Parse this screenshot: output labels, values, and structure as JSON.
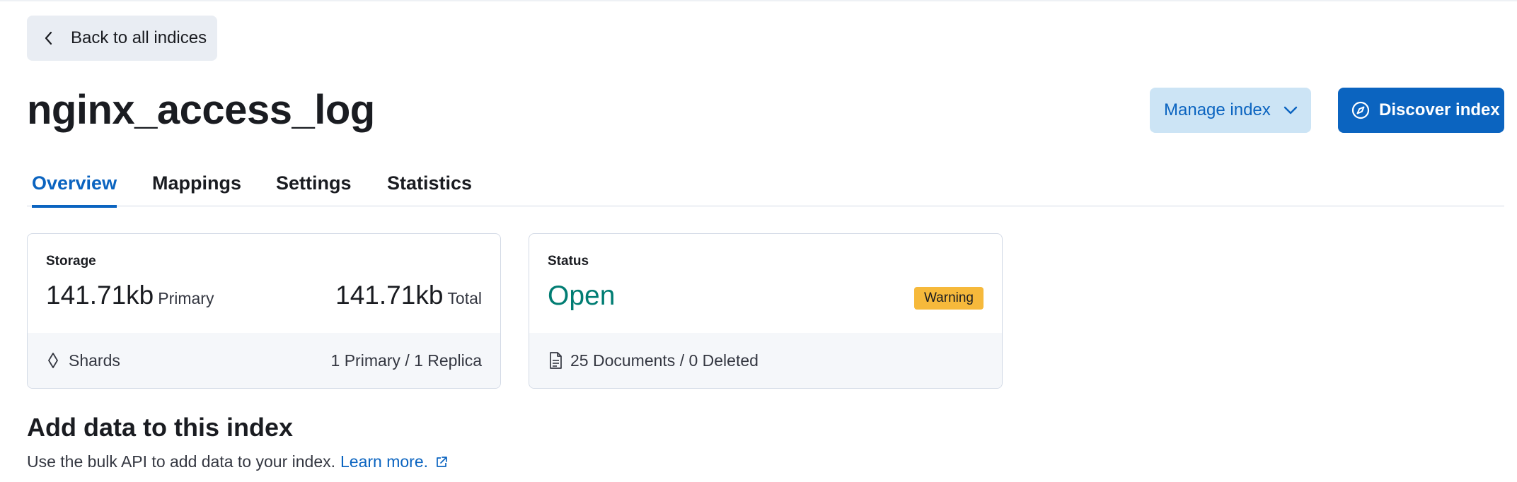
{
  "back_button": {
    "label": "Back to all indices",
    "icon": "chevron-left-icon"
  },
  "page_title": "nginx_access_log",
  "header_actions": {
    "manage_label": "Manage index",
    "discover_label": "Discover index"
  },
  "tabs": [
    {
      "label": "Overview",
      "active": true
    },
    {
      "label": "Mappings",
      "active": false
    },
    {
      "label": "Settings",
      "active": false
    },
    {
      "label": "Statistics",
      "active": false
    }
  ],
  "storage_card": {
    "label": "Storage",
    "primary_value": "141.71kb",
    "primary_unit": "Primary",
    "total_value": "141.71kb",
    "total_unit": "Total",
    "footer_label": "Shards",
    "footer_value": "1 Primary / 1 Replica"
  },
  "status_card": {
    "label": "Status",
    "value": "Open",
    "badge": "Warning",
    "footer_value": "25 Documents / 0 Deleted"
  },
  "add_data": {
    "title": "Add data to this index",
    "description": "Use the bulk API to add data to your index.",
    "link": "Learn more."
  },
  "colors": {
    "accent": "#0b64c0",
    "status_open": "#017d73",
    "warning": "#f6b93b"
  }
}
